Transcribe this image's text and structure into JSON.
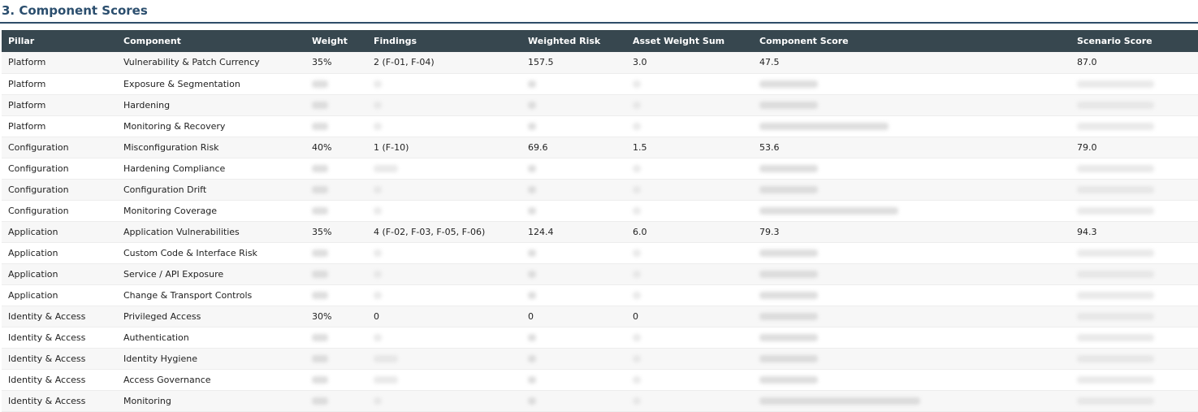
{
  "section": {
    "title": "3. Component Scores"
  },
  "table": {
    "columns": [
      "Pillar",
      "Component",
      "Weight",
      "Findings",
      "Weighted Risk",
      "Asset Weight Sum",
      "Component Score",
      "Scenario Score"
    ],
    "rows": [
      {
        "pillar": "Platform",
        "component": "Vulnerability & Patch Currency",
        "weight": "35%",
        "findings": "2 (F-01, F-04)",
        "weighted_risk": "157.5",
        "asset_weight_sum": "3.0",
        "component_score": "47.5",
        "scenario_score": "87.0"
      },
      {
        "pillar": "Platform",
        "component": "Exposure & Segmentation",
        "redacted": true
      },
      {
        "pillar": "Platform",
        "component": "Hardening",
        "redacted": true
      },
      {
        "pillar": "Platform",
        "component": "Monitoring & Recovery",
        "redacted": true
      },
      {
        "pillar": "Configuration",
        "component": "Misconfiguration Risk",
        "weight": "40%",
        "findings": "1 (F-10)",
        "weighted_risk": "69.6",
        "asset_weight_sum": "1.5",
        "component_score": "53.6",
        "scenario_score": "79.0"
      },
      {
        "pillar": "Configuration",
        "component": "Hardening Compliance",
        "redacted": true
      },
      {
        "pillar": "Configuration",
        "component": "Configuration Drift",
        "redacted": true
      },
      {
        "pillar": "Configuration",
        "component": "Monitoring Coverage",
        "redacted": true
      },
      {
        "pillar": "Application",
        "component": "Application Vulnerabilities",
        "weight": "35%",
        "findings": "4 (F-02, F-03, F-05, F-06)",
        "weighted_risk": "124.4",
        "asset_weight_sum": "6.0",
        "component_score": "79.3",
        "scenario_score": "94.3"
      },
      {
        "pillar": "Application",
        "component": "Custom Code & Interface Risk",
        "redacted": true
      },
      {
        "pillar": "Application",
        "component": "Service / API Exposure",
        "redacted": true
      },
      {
        "pillar": "Application",
        "component": "Change & Transport Controls",
        "redacted": true
      },
      {
        "pillar": "Identity & Access",
        "component": "Privileged Access",
        "weight": "30%",
        "findings": "0",
        "weighted_risk": "0",
        "asset_weight_sum": "0",
        "redacted_tail": true
      },
      {
        "pillar": "Identity & Access",
        "component": "Authentication",
        "redacted": true
      },
      {
        "pillar": "Identity & Access",
        "component": "Identity Hygiene",
        "redacted": true
      },
      {
        "pillar": "Identity & Access",
        "component": "Access Governance",
        "redacted": true
      },
      {
        "pillar": "Identity & Access",
        "component": "Monitoring",
        "redacted": true
      }
    ]
  }
}
